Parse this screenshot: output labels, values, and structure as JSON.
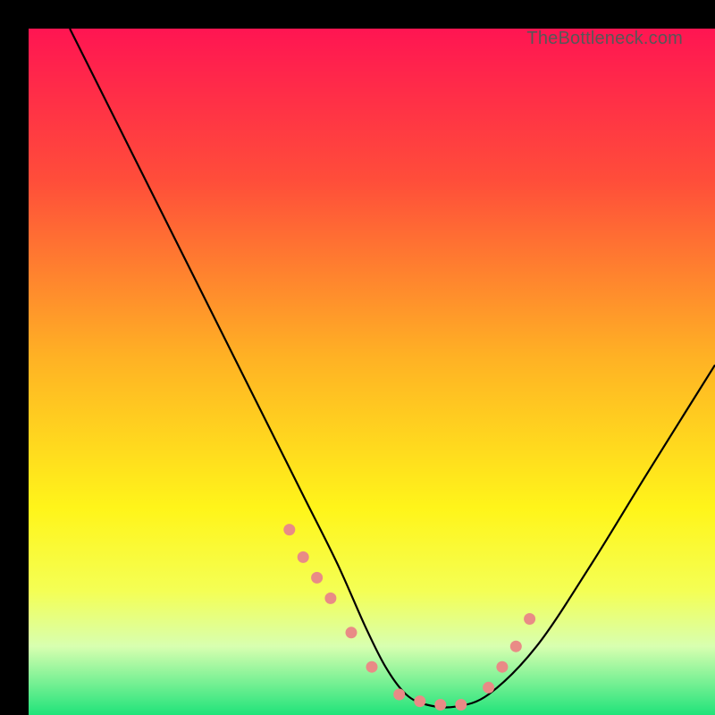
{
  "watermark": "TheBottleneck.com",
  "bg_gradient": {
    "stops": [
      {
        "offset": "0%",
        "color": "#ff1552"
      },
      {
        "offset": "22%",
        "color": "#ff4d3a"
      },
      {
        "offset": "48%",
        "color": "#ffb224"
      },
      {
        "offset": "70%",
        "color": "#fff51a"
      },
      {
        "offset": "82%",
        "color": "#f4ff55"
      },
      {
        "offset": "90%",
        "color": "#d8ffb0"
      },
      {
        "offset": "100%",
        "color": "#20e37a"
      }
    ]
  },
  "chart_data": {
    "type": "line",
    "title": "",
    "xlabel": "",
    "ylabel": "",
    "xlim": [
      0,
      100
    ],
    "ylim": [
      0,
      100
    ],
    "series": [
      {
        "name": "bottleneck-curve",
        "x": [
          6,
          10,
          15,
          20,
          25,
          30,
          35,
          40,
          45,
          49,
          52,
          55,
          58,
          62,
          67,
          74,
          82,
          90,
          100
        ],
        "values": [
          100,
          92,
          82,
          72,
          62,
          52,
          42,
          32,
          22,
          13,
          7,
          3,
          1.5,
          1.2,
          3,
          10,
          22,
          35,
          51
        ]
      }
    ],
    "markers": {
      "name": "highlight-dots",
      "x": [
        38,
        40,
        42,
        44,
        47,
        50,
        54,
        57,
        60,
        63,
        67,
        69,
        71,
        73
      ],
      "values": [
        27,
        23,
        20,
        17,
        12,
        7,
        3,
        2,
        1.5,
        1.5,
        4,
        7,
        10,
        14
      ],
      "color": "#e98b86",
      "r": 6.5
    }
  }
}
